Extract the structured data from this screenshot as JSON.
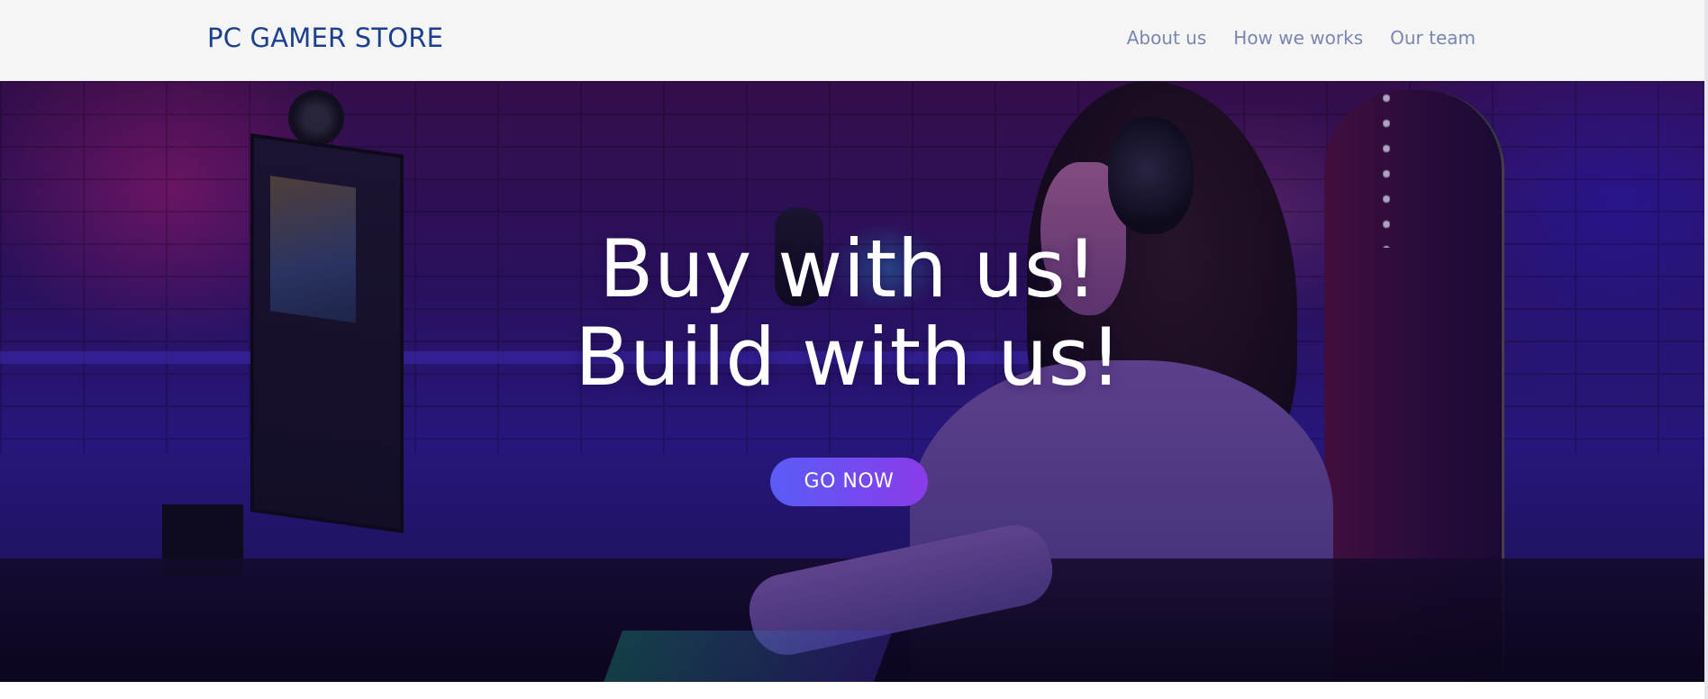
{
  "header": {
    "brand": "PC GAMER STORE",
    "nav": [
      {
        "label": "About us"
      },
      {
        "label": "How we works"
      },
      {
        "label": "Our team"
      }
    ]
  },
  "hero": {
    "title_line1": "Buy with us!",
    "title_line2": "Build with us!",
    "cta_label": "GO NOW",
    "background_image": "gamer-woman-at-desk-image"
  },
  "colors": {
    "brand": "#1c3f8e",
    "nav_link": "#7a86b0",
    "cta_gradient_start": "#5a5cf6",
    "cta_gradient_end": "#8a3be9",
    "header_bg": "#f5f5f6"
  }
}
